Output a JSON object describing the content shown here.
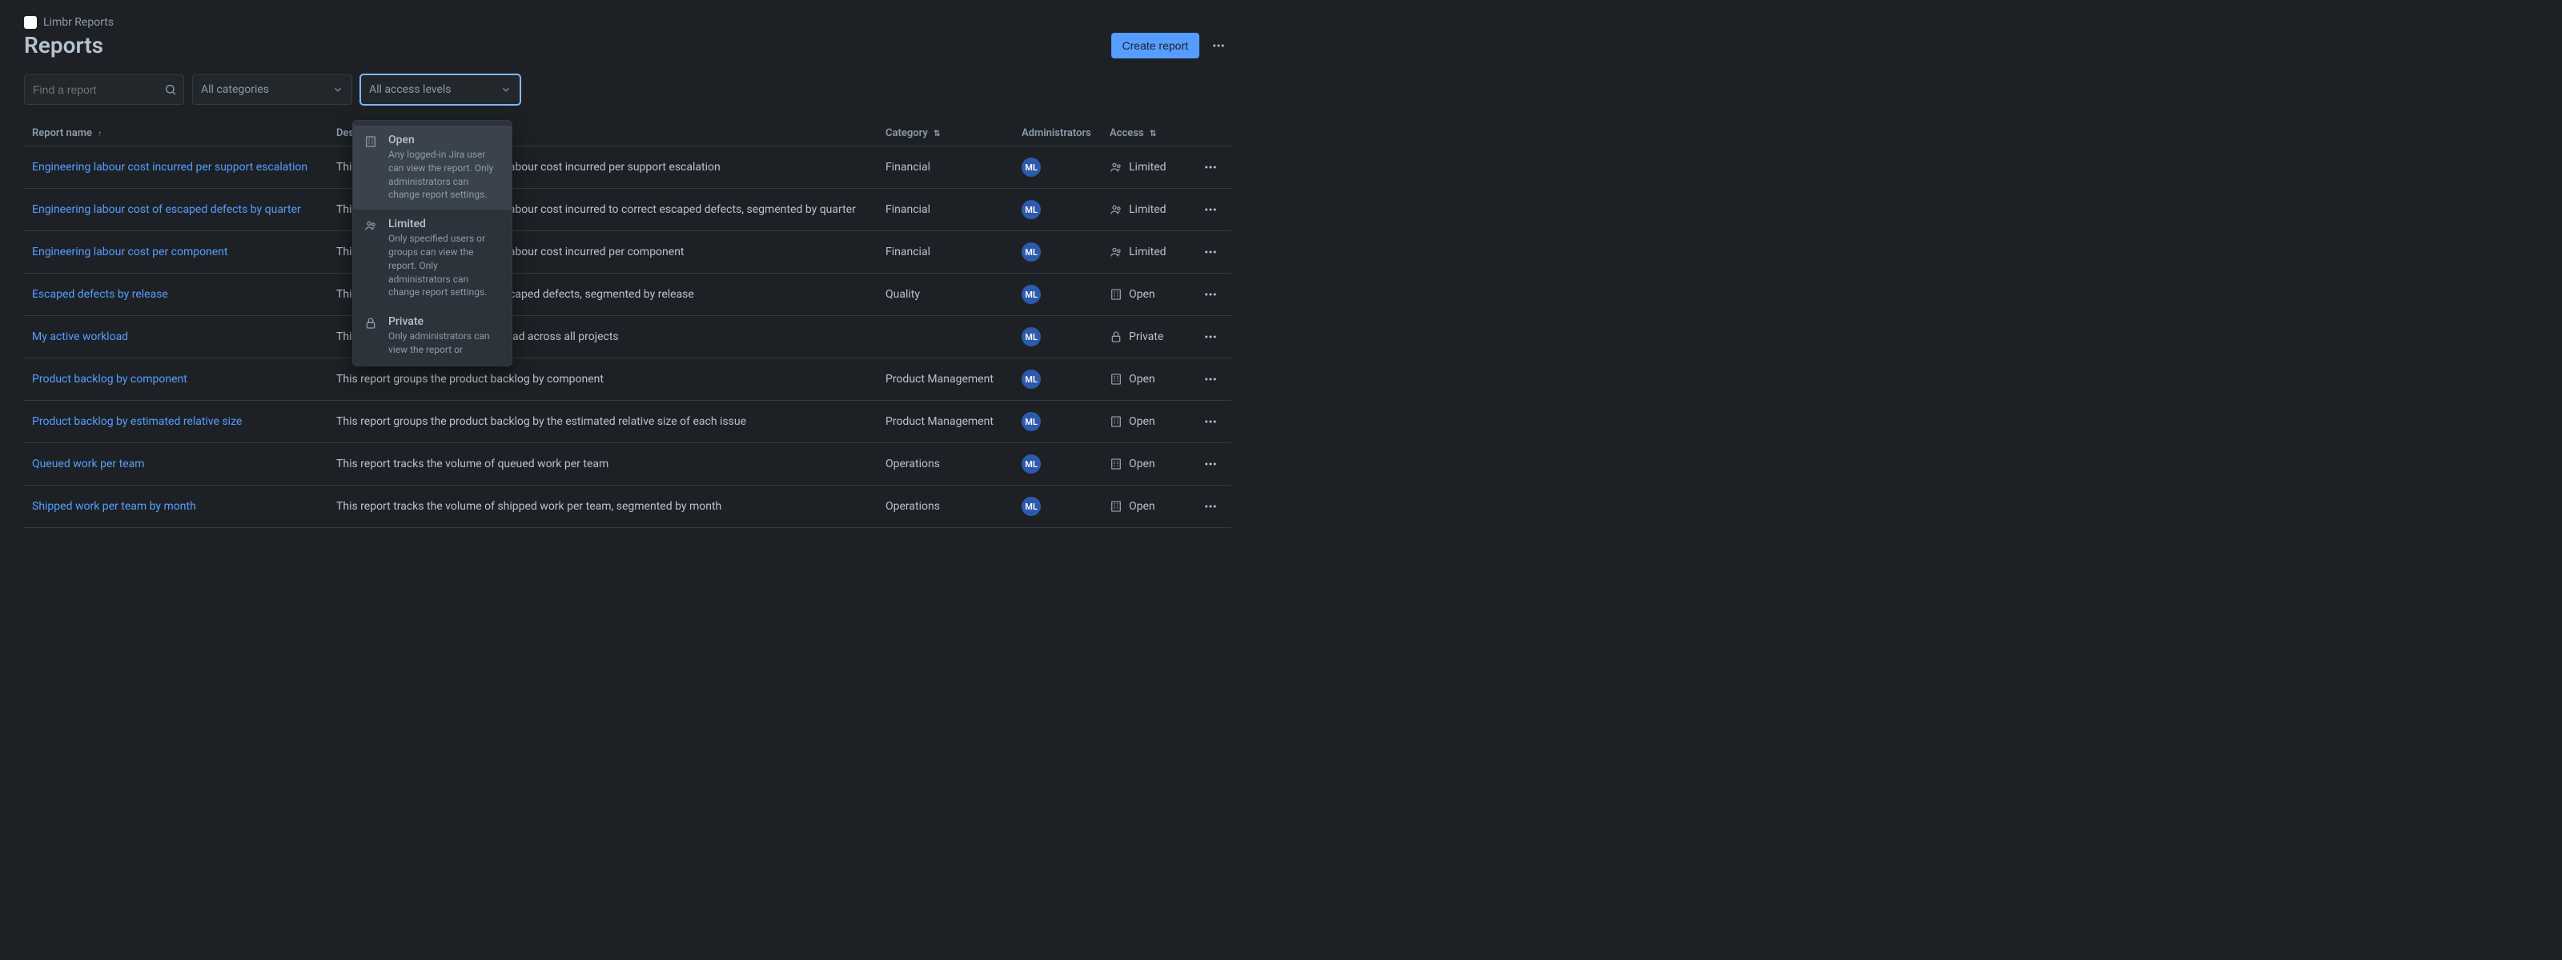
{
  "breadcrumb": {
    "app": "Limbr Reports"
  },
  "page_title": "Reports",
  "header": {
    "create_label": "Create report"
  },
  "filters": {
    "search_placeholder": "Find a report",
    "category_label": "All categories",
    "access_label": "All access levels"
  },
  "access_dropdown": {
    "options": [
      {
        "key": "open",
        "title": "Open",
        "desc": "Any logged-in Jira user can view the report. Only administrators can change report settings.",
        "icon": "building"
      },
      {
        "key": "limited",
        "title": "Limited",
        "desc": "Only specified users or groups can view the report. Only administrators can change report settings.",
        "icon": "group"
      },
      {
        "key": "private",
        "title": "Private",
        "desc": "Only administrators can view the report or",
        "icon": "lock"
      }
    ]
  },
  "columns": {
    "name": "Report name",
    "description": "Description",
    "category": "Category",
    "administrators": "Administrators",
    "access": "Access"
  },
  "admin_initials": "ML",
  "rows": [
    {
      "name": "Engineering labour cost incurred per support escalation",
      "desc": "This report tracks the engineering labour cost incurred per support escalation",
      "category": "Financial",
      "access": "Limited",
      "access_icon": "group"
    },
    {
      "name": "Engineering labour cost of escaped defects by quarter",
      "desc": "This report tracks the engineering labour cost incurred to correct escaped defects, segmented by quarter",
      "category": "Financial",
      "access": "Limited",
      "access_icon": "group"
    },
    {
      "name": "Engineering labour cost per component",
      "desc": "This report tracks the engineering labour cost incurred per component",
      "category": "Financial",
      "access": "Limited",
      "access_icon": "group"
    },
    {
      "name": "Escaped defects by release",
      "desc": "This report tracks the volume of escaped defects, segmented by release",
      "category": "Quality",
      "access": "Open",
      "access_icon": "building"
    },
    {
      "name": "My active workload",
      "desc": "This report shows my active workload across all projects",
      "category": "",
      "access": "Private",
      "access_icon": "lock"
    },
    {
      "name": "Product backlog by component",
      "desc": "This report groups the product backlog by component",
      "category": "Product Management",
      "access": "Open",
      "access_icon": "building"
    },
    {
      "name": "Product backlog by estimated relative size",
      "desc": "This report groups the product backlog by the estimated relative size of each issue",
      "category": "Product Management",
      "access": "Open",
      "access_icon": "building"
    },
    {
      "name": "Queued work per team",
      "desc": "This report tracks the volume of queued work per team",
      "category": "Operations",
      "access": "Open",
      "access_icon": "building"
    },
    {
      "name": "Shipped work per team by month",
      "desc": "This report tracks the volume of shipped work per team, segmented by month",
      "category": "Operations",
      "access": "Open",
      "access_icon": "building"
    }
  ]
}
